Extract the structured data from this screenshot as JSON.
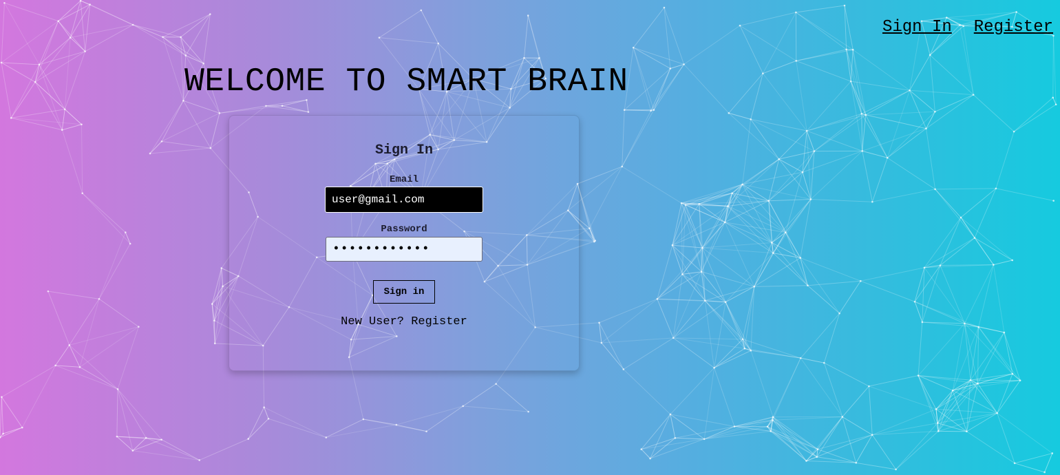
{
  "nav": {
    "sign_in": "Sign In",
    "register": "Register"
  },
  "title": "WELCOME TO SMART BRAIN",
  "card": {
    "heading": "Sign In",
    "email_label": "Email",
    "email_value": "user@gmail.com",
    "password_label": "Password",
    "password_value": "••••••••••••",
    "submit_label": "Sign in",
    "register_link": "New User? Register"
  },
  "colors": {
    "gradient_left": "#d377de",
    "gradient_right": "#16cadf",
    "network_lines": "#ffffff"
  }
}
